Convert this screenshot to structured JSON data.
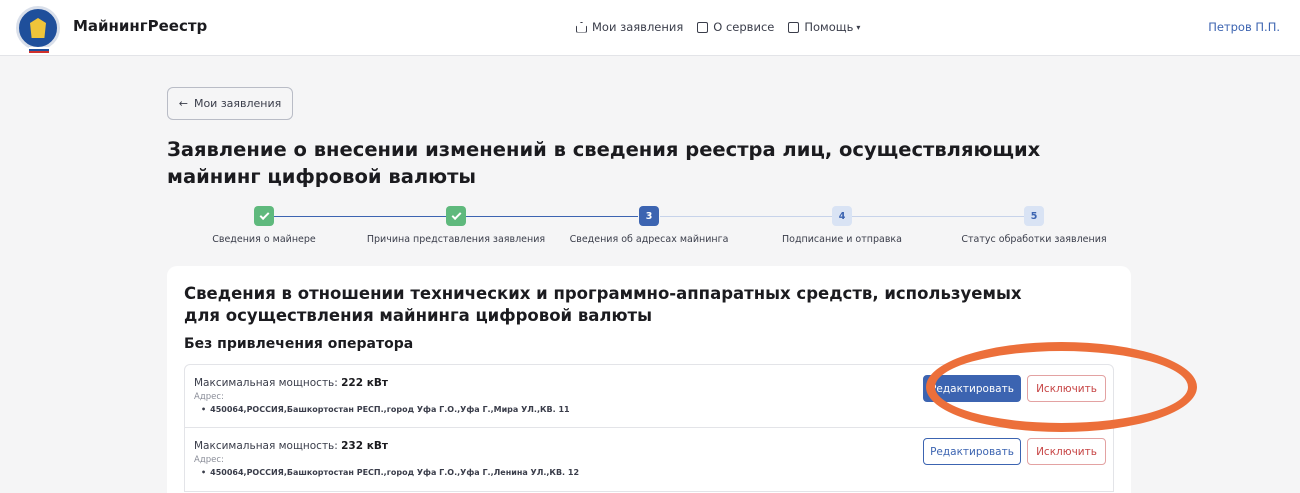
{
  "header": {
    "brand": "МайнингРеестр",
    "nav": [
      {
        "label": "Мои заявления",
        "icon": "home-icon"
      },
      {
        "label": "О сервисе",
        "icon": "document-icon"
      },
      {
        "label": "Помощь",
        "icon": "help-icon",
        "caret": "▾"
      }
    ],
    "user": "Петров П.П."
  },
  "back_button": {
    "arrow": "←",
    "label": "Мои заявления"
  },
  "page_title": "Заявление о внесении изменений в сведения реестра лиц, осуществляющих майнинг цифровой валюты",
  "steps": [
    {
      "number": "1",
      "label": "Сведения о майнере",
      "status": "done"
    },
    {
      "number": "2",
      "label": "Причина представления заявления",
      "status": "done"
    },
    {
      "number": "3",
      "label": "Сведения об адресах майнинга",
      "status": "current"
    },
    {
      "number": "4",
      "label": "Подписание и отправка",
      "status": "todo"
    },
    {
      "number": "5",
      "label": "Статус обработки заявления",
      "status": "todo"
    }
  ],
  "card": {
    "title": "Сведения в отношении технических и программно-аппаратных средств, используемых для осуществления майнинга цифровой валюты",
    "subtitle": "Без привлечения оператора",
    "rows": [
      {
        "power_label": "Максимальная мощность:",
        "power_value": "222 кВт",
        "address_label": "Адрес:",
        "address": "450064,РОССИЯ,Башкортостан РЕСП.,город Уфа Г.О.,Уфа Г.,Мира УЛ.,КВ. 11",
        "edit_label": "Редактировать",
        "exclude_label": "Исключить"
      },
      {
        "power_label": "Максимальная мощность:",
        "power_value": "232 кВт",
        "address_label": "Адрес:",
        "address": "450064,РОССИЯ,Башкортостан РЕСП.,город Уфа Г.О.,Уфа Г.,Ленина УЛ.,КВ. 12",
        "edit_label": "Редактировать",
        "exclude_label": "Исключить"
      }
    ]
  },
  "colors": {
    "primary": "#3c64b1",
    "done": "#5fb97d",
    "danger": "#c74545",
    "annotation": "#ec6f3a"
  }
}
